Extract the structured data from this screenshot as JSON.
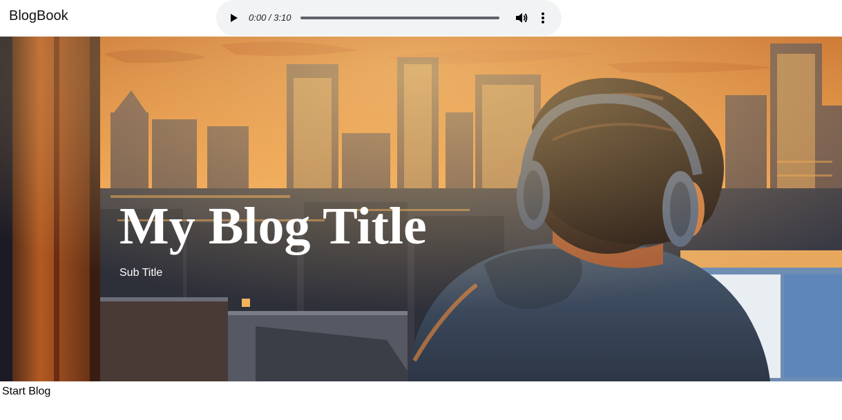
{
  "header": {
    "brand": "BlogBook"
  },
  "audio_player": {
    "time_display": "0:00 / 3:10",
    "progress": 0,
    "play_icon": "play-icon",
    "volume_icon": "volume-icon",
    "more_icon": "more-vert-icon"
  },
  "hero": {
    "title": "My Blog Title",
    "subtitle": "Sub Title",
    "image_description_icon": "city-skyline-headphones-illustration"
  },
  "footer": {
    "start_blog": "Start Blog"
  },
  "colors": {
    "player_bg": "#f1f3f4",
    "sky_top": "#c8712e",
    "sky_bottom": "#f0a14a",
    "hero_text": "#ffffff"
  }
}
